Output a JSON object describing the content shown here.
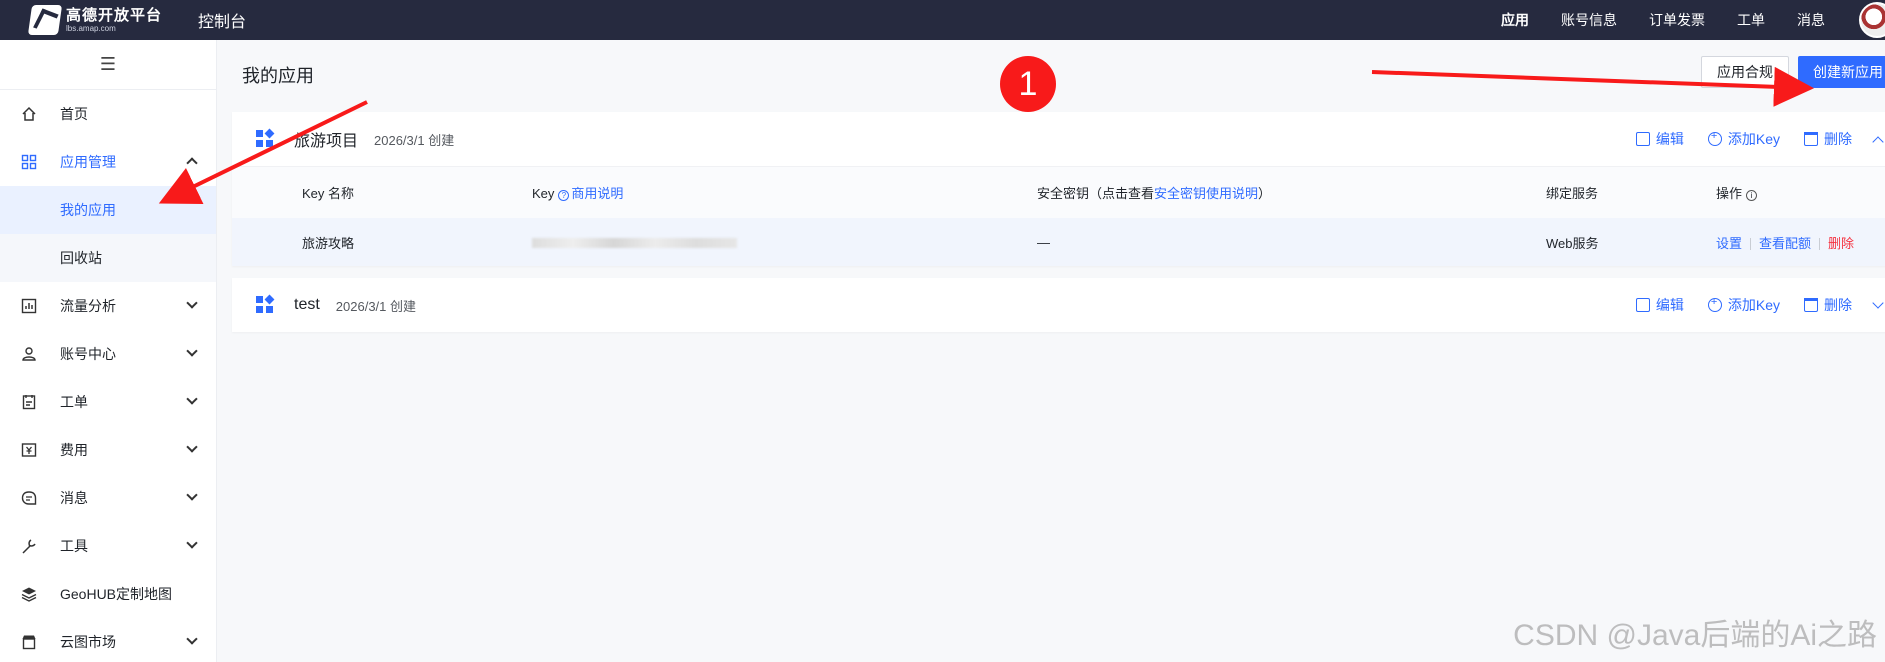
{
  "topbar": {
    "logo_title": "高德开放平台",
    "logo_sub": "lbs.amap.com",
    "console": "控制台",
    "nav": [
      "应用",
      "账号信息",
      "订单发票",
      "工单",
      "消息"
    ]
  },
  "sidebar": {
    "items": [
      {
        "label": "首页",
        "icon": "home-icon"
      },
      {
        "label": "应用管理",
        "icon": "grid-icon"
      },
      {
        "label": "我的应用"
      },
      {
        "label": "回收站"
      },
      {
        "label": "流量分析",
        "icon": "chart-icon"
      },
      {
        "label": "账号中心",
        "icon": "user-icon"
      },
      {
        "label": "工单",
        "icon": "ticket-icon"
      },
      {
        "label": "费用",
        "icon": "money-icon"
      },
      {
        "label": "消息",
        "icon": "message-icon"
      },
      {
        "label": "工具",
        "icon": "wrench-icon"
      },
      {
        "label": "GeoHUB定制地图",
        "icon": "layers-icon"
      },
      {
        "label": "云图市场",
        "icon": "store-icon"
      }
    ]
  },
  "main": {
    "title": "我的应用",
    "compliance_label": "应用合规",
    "create_label": "创建新应用",
    "apps": [
      {
        "name": "旅游项目",
        "date": "2026/3/1 创建"
      },
      {
        "name": "test",
        "date": "2026/3/1 创建"
      }
    ],
    "actions": {
      "edit": "编辑",
      "add_key": "添加Key",
      "delete": "删除"
    },
    "table": {
      "headers": {
        "key_name": "Key 名称",
        "key": "Key",
        "key_help": "商用说明",
        "secret_prefix": "安全密钥（点击查看",
        "secret_link": "安全密钥使用说明",
        "secret_suffix": "）",
        "service": "绑定服务",
        "ops": "操作"
      },
      "row": {
        "name": "旅游攻略",
        "secret": "—",
        "service": "Web服务",
        "op_settings": "设置",
        "op_quota": "查看配额",
        "op_delete": "删除"
      }
    }
  },
  "annotation": {
    "badge": "1"
  },
  "watermark": "CSDN @Java后端的Ai之路",
  "colors": {
    "accent": "#2f6bff",
    "topbar": "#262a3f",
    "danger": "#f5313f",
    "annotation": "#f81a1a"
  }
}
